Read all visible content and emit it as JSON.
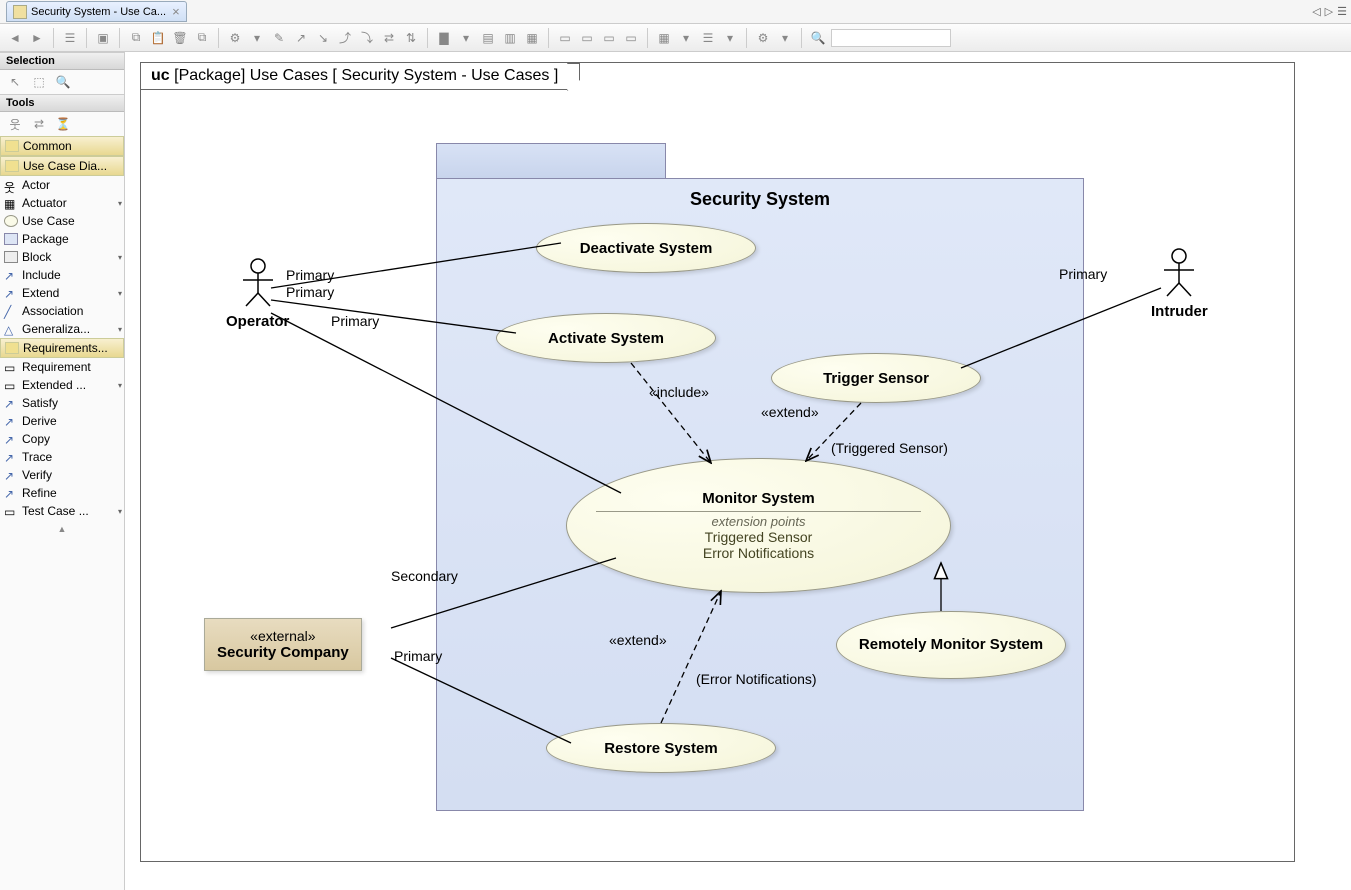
{
  "tab": {
    "title": "Security System - Use Ca...",
    "close": "×"
  },
  "topbar_nav": {
    "left": "◁",
    "right": "▷",
    "list": "☰"
  },
  "palette": {
    "selection_header": "Selection",
    "tools_header": "Tools",
    "common_header": "Common",
    "diagram_header": "Use Case Dia...",
    "req_header": "Requirements...",
    "items": {
      "actor": "Actor",
      "actuator": "Actuator",
      "usecase": "Use Case",
      "package": "Package",
      "block": "Block",
      "include": "Include",
      "extend": "Extend",
      "association": "Association",
      "generalization": "Generaliza...",
      "requirement": "Requirement",
      "extended": "Extended ...",
      "satisfy": "Satisfy",
      "derive": "Derive",
      "copy": "Copy",
      "trace": "Trace",
      "verify": "Verify",
      "refine": "Refine",
      "testcase": "Test Case ..."
    }
  },
  "diagram": {
    "frame_kind": "uc",
    "frame_label": "[Package] Use Cases [ Security System - Use Cases  ]",
    "package_name": "Security System",
    "actors": {
      "operator": "Operator",
      "intruder": "Intruder",
      "company_stereo": "«external»",
      "company_name": "Security Company"
    },
    "usecases": {
      "deactivate": "Deactivate System",
      "activate": "Activate System",
      "trigger": "Trigger Sensor",
      "monitor": "Monitor System",
      "monitor_extpts_lbl": "extension points",
      "monitor_ep1": "Triggered Sensor",
      "monitor_ep2": "Error Notifications",
      "remotely": "Remotely Monitor System",
      "restore": "Restore System"
    },
    "labels": {
      "primary1": "Primary",
      "primary2": "Primary",
      "primary3": "Primary",
      "primary4": "Primary",
      "primary5": "Primary",
      "secondary": "Secondary",
      "include": "«include»",
      "extend1": "«extend»",
      "extend2": "«extend»",
      "triggered_sensor": "(Triggered Sensor)",
      "error_notif": "(Error Notifications)"
    }
  }
}
